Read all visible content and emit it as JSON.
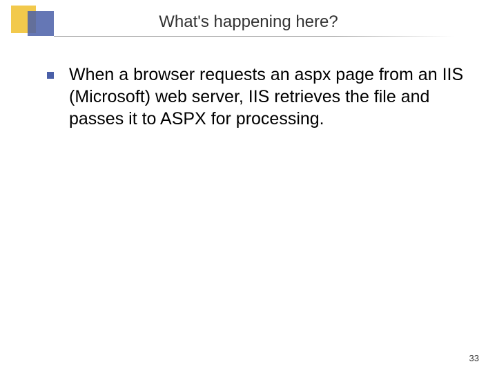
{
  "slide": {
    "title": "What's happening here?",
    "bullet": "When a browser requests an aspx page from an IIS (Microsoft) web server, IIS retrieves the file and passes it to ASPX for processing.",
    "page_number": "33"
  }
}
